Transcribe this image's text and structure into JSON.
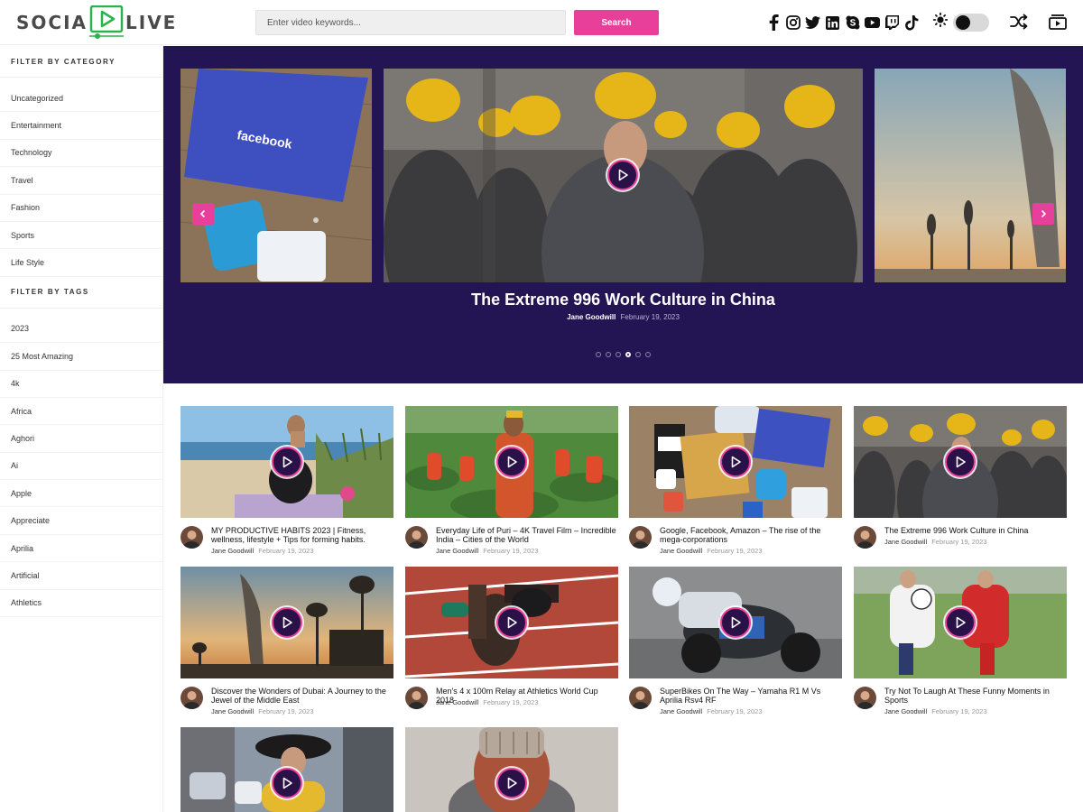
{
  "header": {
    "logo_left": "SOCIA",
    "logo_right": "LIVE",
    "search_placeholder": "Enter video keywords...",
    "search_button": "Search",
    "socials": [
      "facebook-icon",
      "instagram-icon",
      "twitter-icon",
      "linkedin-icon",
      "skype-icon",
      "youtube-icon",
      "twitch-icon",
      "tiktok-icon"
    ],
    "dark_mode": false
  },
  "sidebar": {
    "category_heading": "FILTER BY CATEGORY",
    "categories": [
      "Uncategorized",
      "Entertainment",
      "Technology",
      "Travel",
      "Fashion",
      "Sports",
      "Life Style"
    ],
    "tags_heading": "FILTER BY TAGS",
    "tags": [
      "2023",
      "25 Most Amazing",
      "4k",
      "Africa",
      "Aghori",
      "Ai",
      "Apple",
      "Appreciate",
      "Aprilia",
      "Artificial",
      "Athletics"
    ]
  },
  "hero": {
    "title": "The Extreme 996 Work Culture in China",
    "author": "Jane Goodwill",
    "date": "February 19, 2023",
    "slide_count": 6,
    "active_slide": 3
  },
  "videos": [
    {
      "title": "MY PRODUCTIVE HABITS 2023 | Fitness, wellness, lifestyle + Tips for forming habits.",
      "author": "Jane Goodwill",
      "date": "February 19, 2023"
    },
    {
      "title": "Everyday Life of Puri – 4K Travel Film – Incredible India – Cities of the World",
      "author": "Jane Goodwill",
      "date": "February 19, 2023"
    },
    {
      "title": "Google, Facebook, Amazon – The rise of the mega-corporations",
      "author": "Jane Goodwill",
      "date": "February 19, 2023"
    },
    {
      "title": "The Extreme 996 Work Culture in China",
      "author": "Jane Goodwill",
      "date": "February 19, 2023"
    },
    {
      "title": "Discover the Wonders of Dubai: A Journey to the Jewel of the Middle East",
      "author": "Jane Goodwill",
      "date": "February 19, 2023"
    },
    {
      "title": "Men's 4 x 100m Relay at Athletics World Cup 2018",
      "author": "Jane Goodwill",
      "date": "February 19, 2023"
    },
    {
      "title": "SuperBikes On The Way – Yamaha R1 M Vs Aprilia Rsv4 RF",
      "author": "Jane Goodwill",
      "date": "February 19, 2023"
    },
    {
      "title": "Try Not To Laugh At These Funny Moments in Sports",
      "author": "Jane Goodwill",
      "date": "February 19, 2023"
    },
    {
      "title": "",
      "author": "",
      "date": ""
    },
    {
      "title": "",
      "author": "",
      "date": ""
    }
  ],
  "colors": {
    "accent": "#e83f9a",
    "hero_bg": "#231553",
    "logo_green": "#2bb24c"
  }
}
